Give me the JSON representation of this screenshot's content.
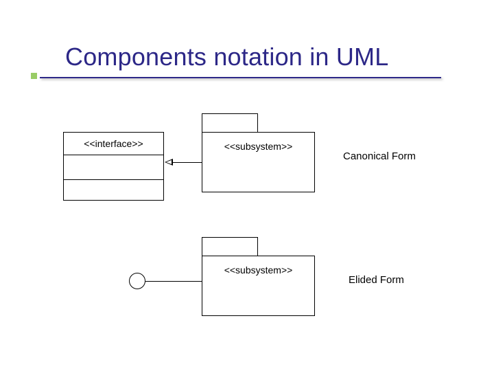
{
  "title": "Components notation in UML",
  "interface": {
    "stereotype": "<<interface>>"
  },
  "canonical": {
    "subsystem_stereotype": "<<subsystem>>",
    "label": "Canonical Form"
  },
  "elided": {
    "subsystem_stereotype": "<<subsystem>>",
    "label": "Elided Form"
  }
}
